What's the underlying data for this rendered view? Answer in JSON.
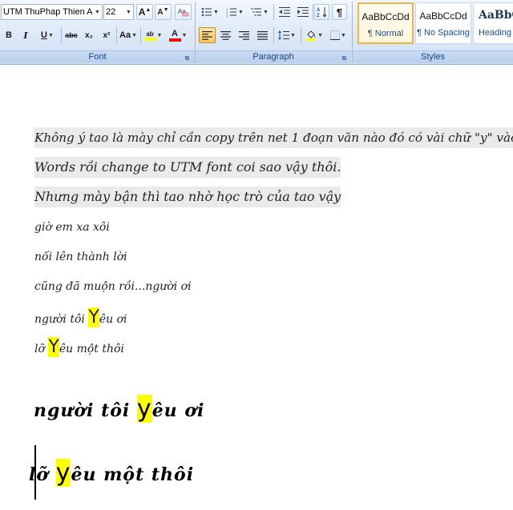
{
  "ribbon": {
    "font": {
      "label": "Font",
      "font_name": "UTM ThuPhap Thien An",
      "font_size": "22",
      "grow_label": "A",
      "shrink_label": "A",
      "bold_label": "B",
      "italic_label": "I",
      "underline_label": "U",
      "strike_label": "abc",
      "subscript_label": "x₂",
      "superscript_label": "x²",
      "case_label": "Aa",
      "highlight_label": "ab",
      "font_color_label": "A",
      "highlight_color": "#ffff00",
      "font_color": "#ff0000"
    },
    "paragraph": {
      "label": "Paragraph",
      "show_marks_label": "¶"
    },
    "styles": {
      "label": "Styles",
      "items": [
        {
          "sample": "AaBbCcDd",
          "name": "¶ Normal"
        },
        {
          "sample": "AaBbCcDd",
          "name": "¶ No Spacing"
        },
        {
          "sample": "AaBbC",
          "name": "Heading"
        }
      ]
    }
  },
  "document": {
    "lines": [
      "Không ý tao là mày chỉ cần copy trên net 1 đoạn văn nào đó có vài chữ \"y\" vào",
      "Words rồi change to UTM font coi sao vậy thôi.",
      "Nhưng mày bận thì tao nhờ học trò của tao vậy",
      "giờ em xa xôi",
      "nối lên thành lời",
      "cũng đã muộn rồi...người ơi"
    ],
    "line7": {
      "before": "người tôi ",
      "highlight": "Y",
      "after": "êu ơi"
    },
    "line8": {
      "before": "lỡ ",
      "highlight": "Y",
      "after": "êu một thôi"
    },
    "big1": {
      "before": "người tôi ",
      "highlight": "y",
      "after": "êu ơi"
    },
    "big2": {
      "before": "lỡ ",
      "highlight": "y",
      "after": "êu một thôi"
    }
  }
}
